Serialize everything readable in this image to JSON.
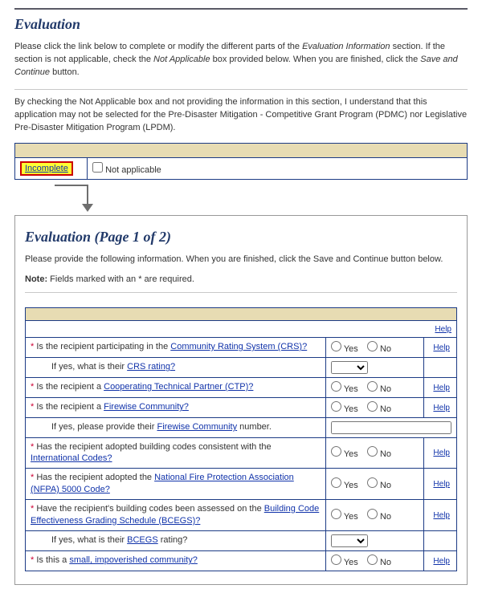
{
  "section1": {
    "title": "Evaluation",
    "intro_pre": "Please click the link below to complete or modify the different parts of the ",
    "intro_em": "Evaluation Information",
    "intro_mid": " section. If the section is not applicable, check the ",
    "intro_em2": "Not Applicable",
    "intro_mid2": " box provided below. When you are finished, click the ",
    "intro_em3": "Save and Continue",
    "intro_post": " button.",
    "notice": "By checking the Not Applicable box and not providing the information in this section, I understand that this application may not be selected for the Pre-Disaster Mitigation - Competitive Grant Program (PDMC) nor Legislative Pre-Disaster Mitigation Program (LPDM).",
    "status_label": "Incomplete",
    "na_label": "Not applicable"
  },
  "section2": {
    "title": "Evaluation (Page 1 of 2)",
    "intro_pre": "Please provide the following information. When you are finished, click the ",
    "intro_em": "Save and Continue",
    "intro_post": " button below.",
    "note_label": "Note:",
    "note_text": " Fields marked with an * are required.",
    "help_label": "Help",
    "yes": "Yes",
    "no": "No",
    "rows": {
      "r1": {
        "pre": "Is the recipient participating in the ",
        "link": "Community Rating System (CRS)?"
      },
      "r1a": {
        "pre": "If yes, what is their ",
        "link": "CRS rating?",
        "selected": ""
      },
      "r2": {
        "pre": "Is the recipient a ",
        "link": "Cooperating Technical Partner (CTP)?"
      },
      "r3": {
        "pre": "Is the recipient a ",
        "link": "Firewise Community?"
      },
      "r3a": {
        "pre": "If yes, please provide their ",
        "link": "Firewise Community",
        "post": " number.",
        "value": ""
      },
      "r4": {
        "pre": "Has the recipient adopted building codes consistent with the ",
        "link": "International Codes?"
      },
      "r5": {
        "pre": "Has the recipient adopted the ",
        "link": "National Fire Protection Association (NFPA) 5000 Code?"
      },
      "r6": {
        "pre": "Have the recipient's building codes been assessed on the ",
        "link": "Building Code Effectiveness Grading Schedule (BCEGS)?"
      },
      "r6a": {
        "pre": "If yes, what is their ",
        "link": "BCEGS",
        "post": " rating?",
        "selected": ""
      },
      "r7": {
        "pre": "Is this a ",
        "link": "small, impoverished community?"
      }
    }
  }
}
